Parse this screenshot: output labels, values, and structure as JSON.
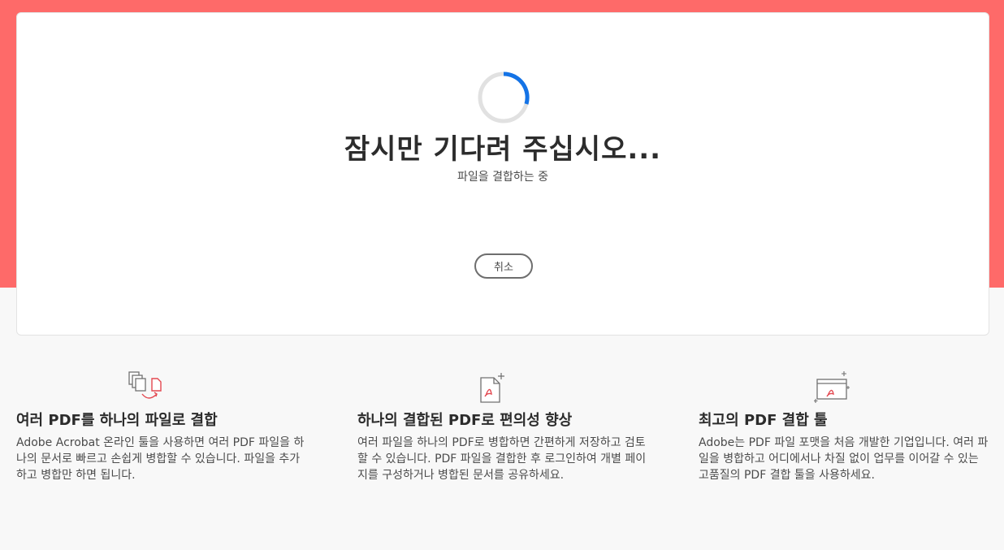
{
  "status": {
    "title": "잠시만 기다려 주십시오...",
    "subtitle": "파일을 결합하는 중",
    "cancel_label": "취소"
  },
  "features": [
    {
      "icon": "combine-files-icon",
      "title": "여러 PDF를 하나의 파일로 결합",
      "desc": "Adobe Acrobat 온라인 툴을 사용하면 여러 PDF 파일을 하나의 문서로 빠르고 손쉽게 병합할 수 있습니다. 파일을 추가하고 병합만 하면 됩니다."
    },
    {
      "icon": "pdf-document-icon",
      "title": "하나의 결합된 PDF로 편의성 향상",
      "desc": "여러 파일을 하나의 PDF로 병합하면 간편하게 저장하고 검토할 수 있습니다. PDF 파일을 결합한 후 로그인하여 개별 페이지를 구성하거나 병합된 문서를 공유하세요."
    },
    {
      "icon": "pdf-window-icon",
      "title": "최고의 PDF 결합 툴",
      "desc": "Adobe는 PDF 파일 포맷을 처음 개발한 기업입니다. 여러 파일을 병합하고 어디에서나 차질 없이 업무를 이어갈 수 있는 고품질의 PDF 결합 툴을 사용하세요."
    }
  ],
  "colors": {
    "hero_background": "#fe6a69",
    "spinner_active": "#1473e6",
    "spinner_track": "#e1e1e1",
    "pdf_red": "#e34850"
  }
}
